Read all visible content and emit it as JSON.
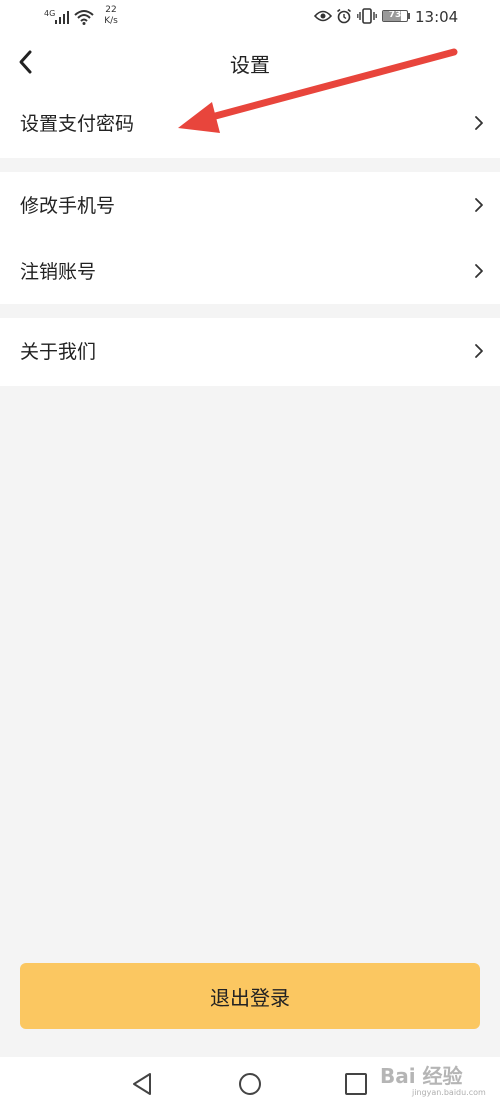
{
  "status_bar": {
    "network": "4G",
    "speed_value": "22",
    "speed_unit": "K/s",
    "battery_percent": 73,
    "battery_text": "73",
    "time": "13:04",
    "icons": [
      "signal-icon",
      "wifi-icon",
      "eye-icon",
      "alarm-icon",
      "vibrate-icon",
      "battery-icon"
    ]
  },
  "header": {
    "title": "设置",
    "back_icon": "chevron-left-icon"
  },
  "sections": [
    {
      "items": [
        {
          "label": "设置支付密码",
          "chevron": ">"
        }
      ]
    },
    {
      "items": [
        {
          "label": "修改手机号",
          "chevron": ">"
        },
        {
          "label": "注销账号",
          "chevron": ">"
        }
      ]
    },
    {
      "items": [
        {
          "label": "关于我们",
          "chevron": ">"
        }
      ]
    }
  ],
  "annotation": {
    "arrow_color": "#e8453c"
  },
  "logout": {
    "label": "退出登录",
    "color": "#fbc761"
  },
  "nav_bar": {
    "buttons": [
      "back-triangle-icon",
      "home-circle-icon",
      "recents-square-icon"
    ]
  },
  "watermark": {
    "text": "Bai 经验",
    "subtext": "jingyan.baidu.com"
  },
  "colors": {
    "background": "#f4f4f4",
    "surface": "#ffffff",
    "text": "#222222"
  }
}
